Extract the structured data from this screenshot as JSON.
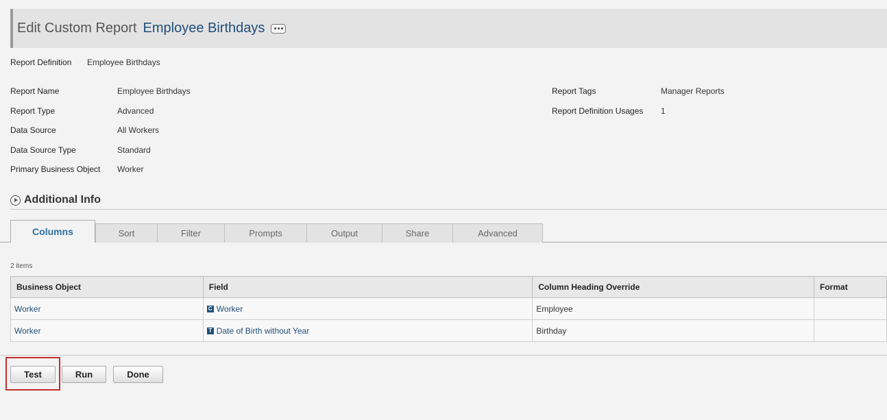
{
  "header": {
    "prefix": "Edit Custom Report",
    "object": "Employee Birthdays"
  },
  "report_definition": {
    "label": "Report Definition",
    "value": "Employee Birthdays"
  },
  "fields_left": [
    {
      "label": "Report Name",
      "value": "Employee Birthdays",
      "is_link": false
    },
    {
      "label": "Report Type",
      "value": "Advanced",
      "is_link": false
    },
    {
      "label": "Data Source",
      "value": "All Workers",
      "is_link": true
    },
    {
      "label": "Data Source Type",
      "value": "Standard",
      "is_link": false
    },
    {
      "label": "Primary Business Object",
      "value": "Worker",
      "is_link": true
    }
  ],
  "fields_right": [
    {
      "label": "Report Tags",
      "value": "Manager Reports"
    },
    {
      "label": "Report Definition Usages",
      "value": "1"
    }
  ],
  "additional_info": "Additional Info",
  "tabs": [
    "Columns",
    "Sort",
    "Filter",
    "Prompts",
    "Output",
    "Share",
    "Advanced"
  ],
  "active_tab": "Columns",
  "item_count": "2 items",
  "table": {
    "columns": [
      "Business Object",
      "Field",
      "Column Heading Override",
      "Format"
    ],
    "rows": [
      {
        "business_object": "Worker",
        "field_icon": "C",
        "field": "Worker",
        "heading": "Employee",
        "format": ""
      },
      {
        "business_object": "Worker",
        "field_icon": "T",
        "field": "Date of Birth without Year",
        "heading": "Birthday",
        "format": ""
      }
    ]
  },
  "buttons": {
    "test": "Test",
    "run": "Run",
    "done": "Done"
  },
  "colors": {
    "link": "#1f4e79",
    "active_tab": "#2f6f9f",
    "highlight": "#c0302c"
  }
}
